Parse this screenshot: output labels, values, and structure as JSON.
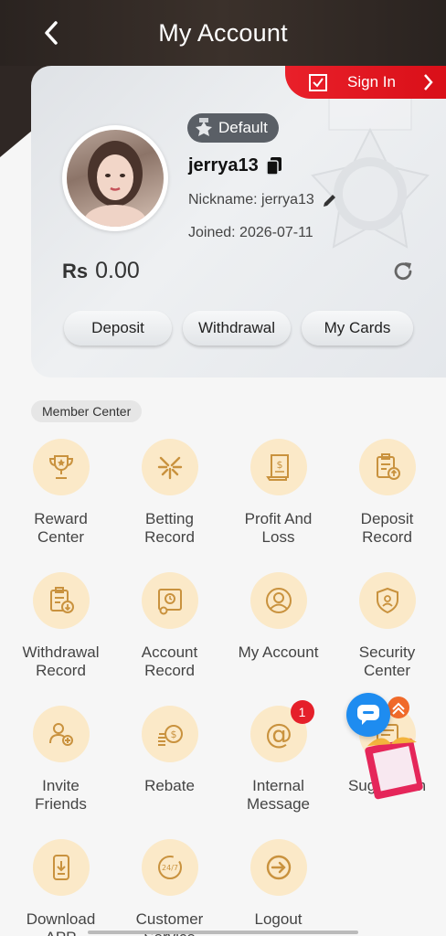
{
  "header": {
    "title": "My Account"
  },
  "profile": {
    "badge": "Default",
    "username": "jerrya13",
    "nickname": "Nickname: jerrya13",
    "joined": "Joined:  2026-07-11",
    "currency": "Rs",
    "balance": "0.00",
    "signin_label": "Sign In"
  },
  "actions": {
    "deposit": "Deposit",
    "withdrawal": "Withdrawal",
    "cards": "My Cards"
  },
  "member_center": {
    "label": "Member Center",
    "items": [
      {
        "label": "Reward\nCenter",
        "icon": "trophy-icon"
      },
      {
        "label": "Betting\nRecord",
        "icon": "betting-icon"
      },
      {
        "label": "Profit And\nLoss",
        "icon": "profit-loss-icon"
      },
      {
        "label": "Deposit\nRecord",
        "icon": "deposit-record-icon"
      },
      {
        "label": "Withdrawal\nRecord",
        "icon": "withdrawal-record-icon"
      },
      {
        "label": "Account\nRecord",
        "icon": "account-record-icon"
      },
      {
        "label": "My Account",
        "icon": "user-icon"
      },
      {
        "label": "Security\nCenter",
        "icon": "shield-icon"
      },
      {
        "label": "Invite\nFriends",
        "icon": "invite-icon"
      },
      {
        "label": "Rebate",
        "icon": "coins-icon"
      },
      {
        "label": "Internal\nMessage",
        "icon": "at-icon",
        "badge": "1"
      },
      {
        "label": "Suggestion",
        "icon": "suggestion-icon"
      },
      {
        "label": "Download\nAPP",
        "icon": "download-icon"
      },
      {
        "label": "Customer\nService",
        "icon": "support-icon"
      },
      {
        "label": "Logout",
        "icon": "logout-icon"
      }
    ]
  },
  "colors": {
    "accent": "#e9202a",
    "gold": "#d9a24a",
    "icon_bg": "#fbe9c8",
    "header_bg": "#2f2724"
  }
}
